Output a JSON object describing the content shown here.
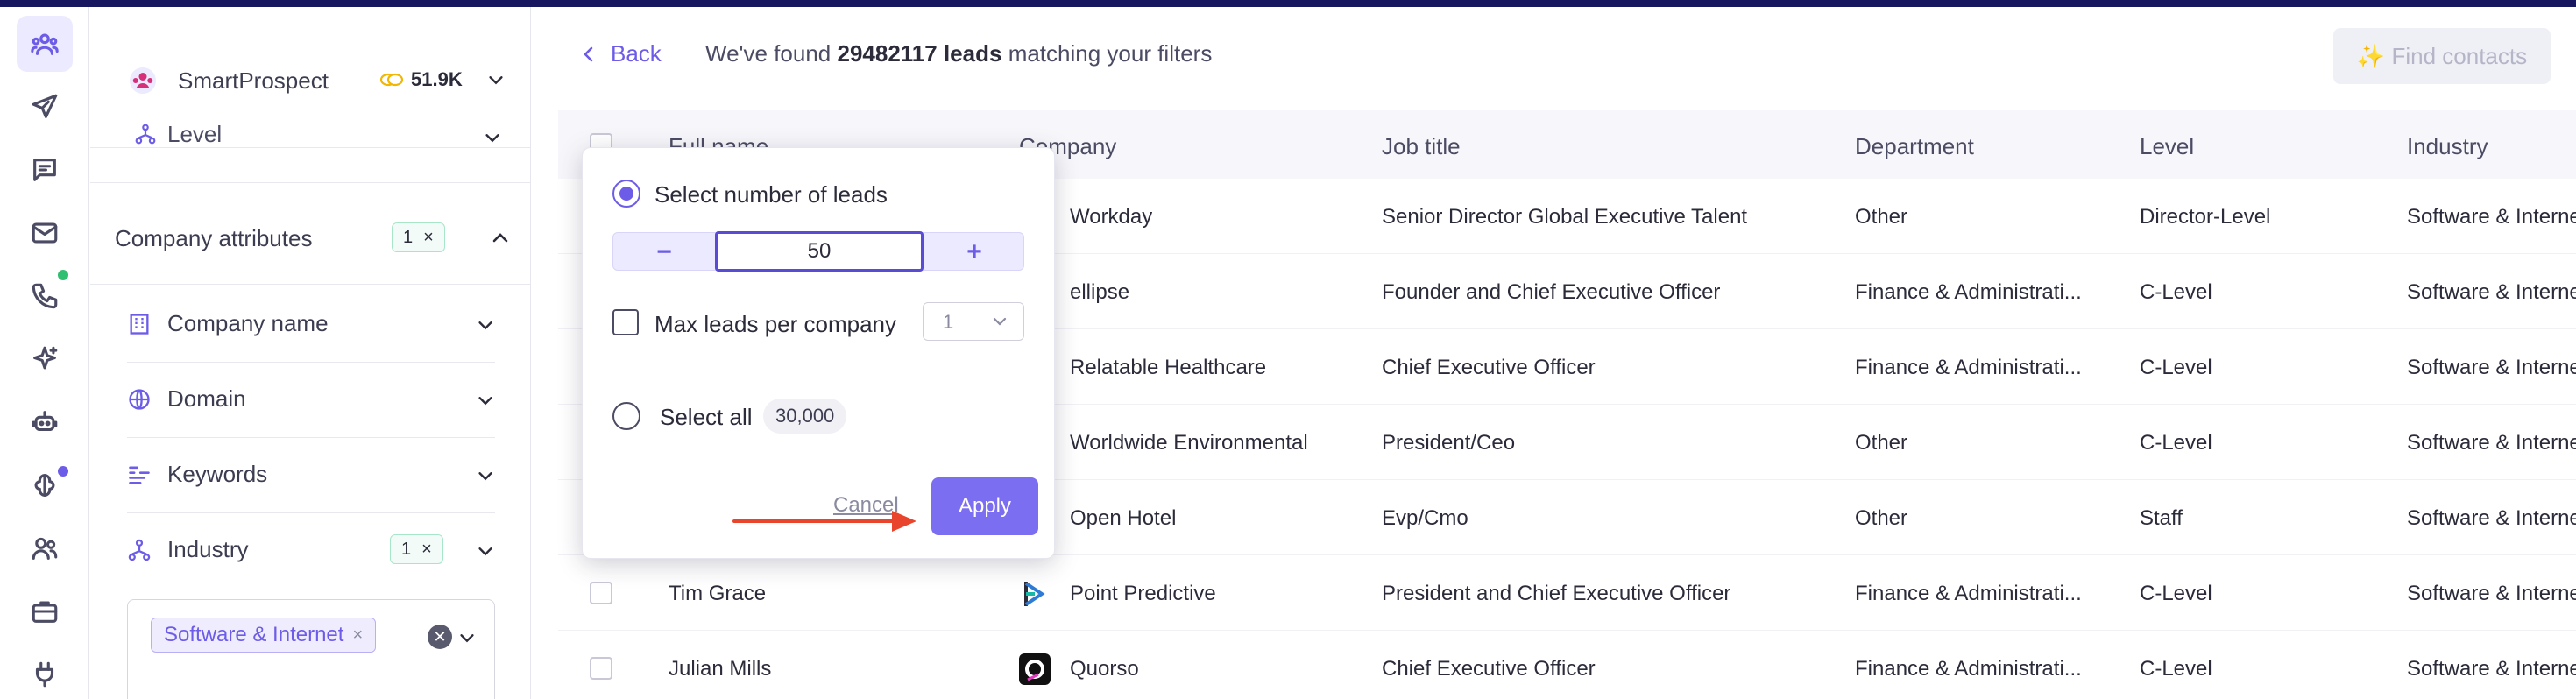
{
  "app": {
    "brand_name": "SmartProspect",
    "credits": "51.9K"
  },
  "sidebar": {
    "level_label": "Level",
    "company_attributes": {
      "title": "Company attributes",
      "badge_count": "1",
      "badge_x": "×"
    },
    "filters": [
      {
        "label": "Company name"
      },
      {
        "label": "Domain"
      },
      {
        "label": "Keywords"
      },
      {
        "label": "Industry",
        "badge_count": "1",
        "badge_x": "×"
      }
    ],
    "industry_chip": {
      "label": "Software & Internet",
      "x": "×"
    }
  },
  "header": {
    "back_label": "Back",
    "found_prefix": "We've found",
    "found_count": "29482117 leads",
    "found_suffix": "matching your filters",
    "find_contacts_label": "✨ Find contacts"
  },
  "table": {
    "columns": [
      "Full name",
      "Company",
      "Job title",
      "Department",
      "Level",
      "Industry"
    ],
    "rows": [
      {
        "name": "",
        "company": "Workday",
        "job": "Senior Director Global Executive Talent",
        "dept": "Other",
        "level": "Director-Level",
        "industry": "Software & Internet"
      },
      {
        "name": "",
        "company": "ellipse",
        "job": "Founder and Chief Executive Officer",
        "dept": "Finance & Administrati...",
        "level": "C-Level",
        "industry": "Software & Internet"
      },
      {
        "name": "",
        "company": "Relatable Healthcare",
        "job": "Chief Executive Officer",
        "dept": "Finance & Administrati...",
        "level": "C-Level",
        "industry": "Software & Internet"
      },
      {
        "name": "",
        "company": "Worldwide Environmental",
        "job": "President/Ceo",
        "dept": "Other",
        "level": "C-Level",
        "industry": "Software & Internet"
      },
      {
        "name": "",
        "company": "Open Hotel",
        "job": "Evp/Cmo",
        "dept": "Other",
        "level": "Staff",
        "industry": "Software & Internet"
      },
      {
        "name": "Tim Grace",
        "company": "Point Predictive",
        "job": "President and Chief Executive Officer",
        "dept": "Finance & Administrati...",
        "level": "C-Level",
        "industry": "Software & Internet"
      },
      {
        "name": "Julian Mills",
        "company": "Quorso",
        "job": "Chief Executive Officer",
        "dept": "Finance & Administrati...",
        "level": "C-Level",
        "industry": "Software & Internet"
      }
    ]
  },
  "popover": {
    "select_number_label": "Select number of leads",
    "minus": "−",
    "plus": "+",
    "lead_count_value": "50",
    "max_per_company_label": "Max leads per company",
    "max_per_company_value": "1",
    "select_all_label": "Select all",
    "select_all_count": "30,000",
    "cancel_label": "Cancel",
    "apply_label": "Apply"
  },
  "colors": {
    "accent": "#6c5ce7",
    "topbar": "#17165e",
    "arrow": "#e8452c",
    "badge_green": "#a8e6c9"
  }
}
